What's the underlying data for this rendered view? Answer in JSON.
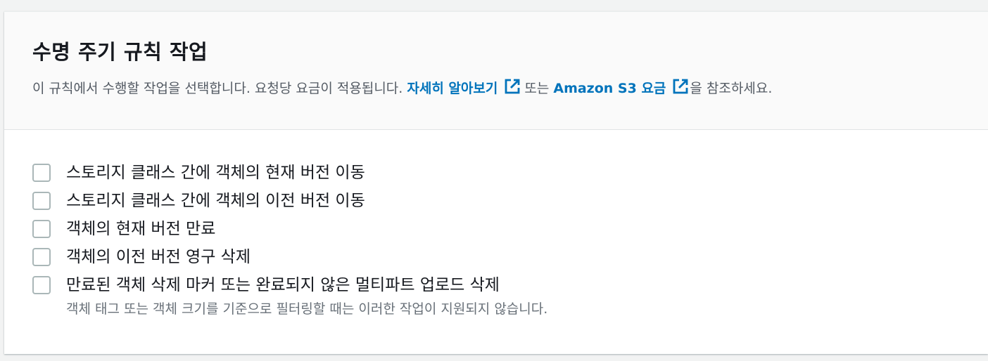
{
  "section": {
    "title": "수명 주기 규칙 작업",
    "description_prefix": "이 규칙에서 수행할 작업을 선택합니다. 요청당 요금이 적용됩니다. ",
    "learn_more_link": "자세히 알아보기",
    "middle_text": "또는",
    "pricing_link": "Amazon S3 요금",
    "description_suffix": "을 참조하세요.",
    "link_color": "#0073bb"
  },
  "actions": [
    {
      "label": "스토리지 클래스 간에 객체의 현재 버전 이동",
      "checked": false
    },
    {
      "label": "스토리지 클래스 간에 객체의 이전 버전 이동",
      "checked": false
    },
    {
      "label": "객체의 현재 버전 만료",
      "checked": false
    },
    {
      "label": "객체의 이전 버전 영구 삭제",
      "checked": false
    },
    {
      "label": "만료된 객체 삭제 마커 또는 완료되지 않은 멀티파트 업로드 삭제",
      "checked": false,
      "hint": "객체 태그 또는 객체 크기를 기준으로 필터링할 때는 이러한 작업이 지원되지 않습니다."
    }
  ],
  "icons": {
    "external_link": "external-link-icon"
  }
}
